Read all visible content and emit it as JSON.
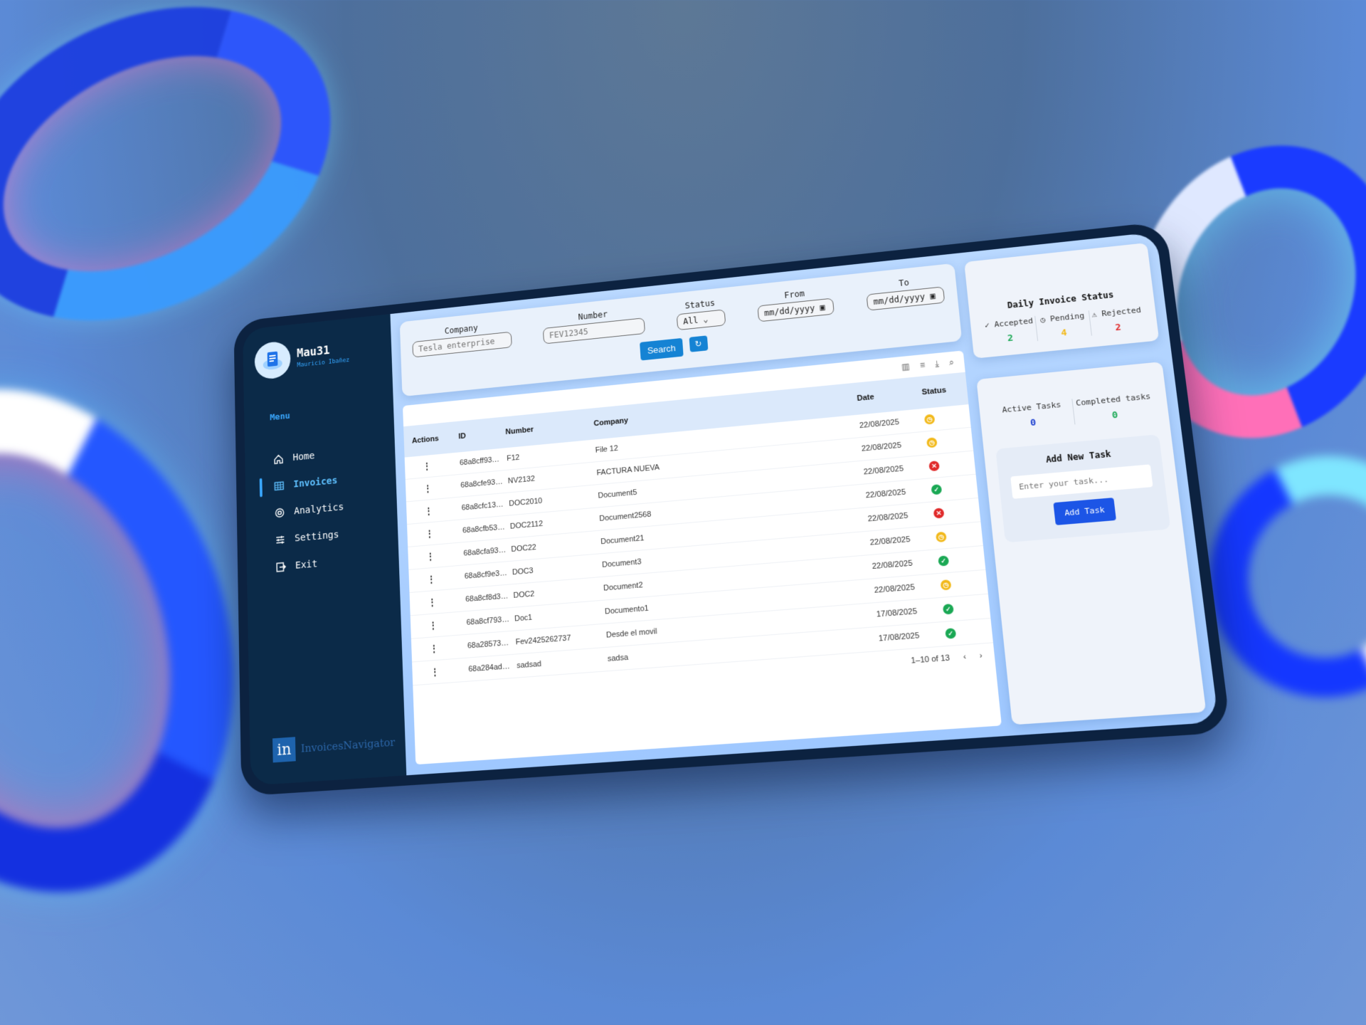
{
  "profile": {
    "name": "Mau31",
    "subtitle": "Mauricio Ibañez"
  },
  "menu": {
    "title": "Menu",
    "items": [
      {
        "label": "Home",
        "icon": "home-icon"
      },
      {
        "label": "Invoices",
        "icon": "table-icon",
        "active": true
      },
      {
        "label": "Analytics",
        "icon": "analytics-icon"
      },
      {
        "label": "Settings",
        "icon": "sliders-icon"
      },
      {
        "label": "Exit",
        "icon": "exit-icon"
      }
    ]
  },
  "brand": {
    "logo": "in",
    "name": "InvoicesNavigator"
  },
  "filters": {
    "company": {
      "label": "Company",
      "placeholder": "Tesla enterprise"
    },
    "number": {
      "label": "Number",
      "placeholder": "FEV12345"
    },
    "status": {
      "label": "Status",
      "value": "All"
    },
    "from": {
      "label": "From",
      "value": "mm/dd/yyyy"
    },
    "to": {
      "label": "To",
      "value": "mm/dd/yyyy"
    },
    "search_label": "Search"
  },
  "table": {
    "columns": [
      "Actions",
      "ID",
      "Number",
      "Company",
      "Date",
      "Status"
    ],
    "rows": [
      {
        "id": "68a8cff93…",
        "number": "F12",
        "company": "File 12",
        "date": "22/08/2025",
        "status": "pending"
      },
      {
        "id": "68a8cfe93…",
        "number": "NV2132",
        "company": "FACTURA NUEVA",
        "date": "22/08/2025",
        "status": "pending"
      },
      {
        "id": "68a8cfc13…",
        "number": "DOC2010",
        "company": "Document5",
        "date": "22/08/2025",
        "status": "rejected"
      },
      {
        "id": "68a8cfb53…",
        "number": "DOC2112",
        "company": "Document2568",
        "date": "22/08/2025",
        "status": "accepted"
      },
      {
        "id": "68a8cfa93…",
        "number": "DOC22",
        "company": "Document21",
        "date": "22/08/2025",
        "status": "rejected"
      },
      {
        "id": "68a8cf9e3…",
        "number": "DOC3",
        "company": "Document3",
        "date": "22/08/2025",
        "status": "pending"
      },
      {
        "id": "68a8cf8d3…",
        "number": "DOC2",
        "company": "Document2",
        "date": "22/08/2025",
        "status": "accepted"
      },
      {
        "id": "68a8cf793…",
        "number": "Doc1",
        "company": "Documento1",
        "date": "22/08/2025",
        "status": "pending"
      },
      {
        "id": "68a28573…",
        "number": "Fev2425262737",
        "company": "Desde el movil",
        "date": "17/08/2025",
        "status": "accepted"
      },
      {
        "id": "68a284ad…",
        "number": "sadsad",
        "company": "sadsa",
        "date": "17/08/2025",
        "status": "accepted"
      }
    ],
    "pagination": "1–10 of 13"
  },
  "daily_status": {
    "title": "Daily Invoice Status",
    "accepted": {
      "label": "Accepted",
      "value": "2",
      "color": "#1aa854"
    },
    "pending": {
      "label": "Pending",
      "value": "4",
      "color": "#f2b91b"
    },
    "rejected": {
      "label": "Rejected",
      "value": "2",
      "color": "#e02a2a"
    }
  },
  "tasks": {
    "active": {
      "label": "Active Tasks",
      "value": "0",
      "color": "#1c3fd0"
    },
    "completed": {
      "label": "Completed tasks",
      "value": "0",
      "color": "#1aa854"
    },
    "add_title": "Add New Task",
    "input_placeholder": "Enter your task...",
    "add_button": "Add Task"
  }
}
